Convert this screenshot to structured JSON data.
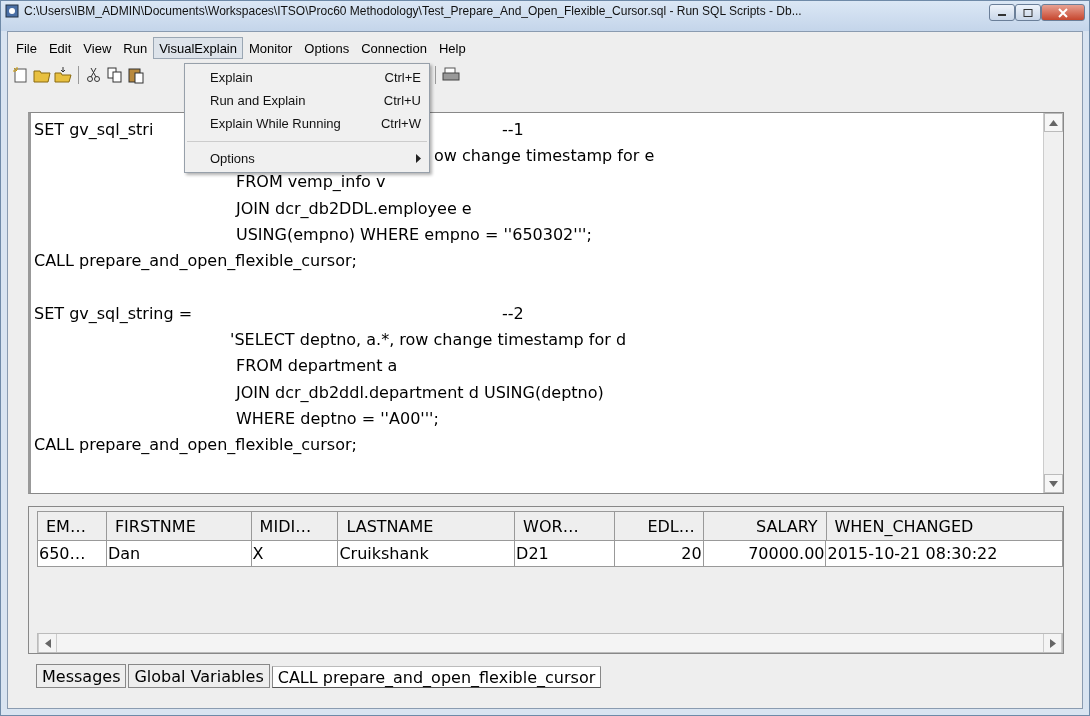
{
  "window": {
    "title": "C:\\Users\\IBM_ADMIN\\Documents\\Workspaces\\ITSO\\Proc60 Methodology\\Test_Prepare_And_Open_Flexible_Cursor.sql - Run SQL Scripts - Db..."
  },
  "menu_bar": [
    {
      "label": "File",
      "selected": false
    },
    {
      "label": "Edit",
      "selected": false
    },
    {
      "label": "View",
      "selected": false
    },
    {
      "label": "Run",
      "selected": false
    },
    {
      "label": "VisualExplain",
      "selected": true
    },
    {
      "label": "Monitor",
      "selected": false
    },
    {
      "label": "Options",
      "selected": false
    },
    {
      "label": "Connection",
      "selected": false
    },
    {
      "label": "Help",
      "selected": false
    }
  ],
  "dropdown": [
    {
      "kind": "item",
      "label": "Explain",
      "shortcut": "Ctrl+E"
    },
    {
      "kind": "item",
      "label": "Run and Explain",
      "shortcut": "Ctrl+U"
    },
    {
      "kind": "item",
      "label": "Explain While Running",
      "shortcut": "Ctrl+W"
    },
    {
      "kind": "separator"
    },
    {
      "kind": "submenu",
      "label": "Options"
    }
  ],
  "editor": [
    {
      "kind": "head",
      "text": "SET gv_sql_stri",
      "comment": "--1"
    },
    {
      "kind": "tail",
      "text": "ow change timestamp for e"
    },
    {
      "kind": "body",
      "text": "FROM vemp_info v"
    },
    {
      "kind": "body",
      "text": "JOIN dcr_db2DDL.employee e"
    },
    {
      "kind": "body",
      "text": "USING(empno) WHERE empno = ''650302''';"
    },
    {
      "kind": "head",
      "text": "CALL prepare_and_open_flexible_cursor;"
    },
    {
      "kind": "blank"
    },
    {
      "kind": "head",
      "text": "SET gv_sql_string =",
      "comment": "--2"
    },
    {
      "kind": "quote",
      "text": "'SELECT deptno, a.*, row change timestamp for d"
    },
    {
      "kind": "body",
      "text": "FROM department a"
    },
    {
      "kind": "body",
      "text": "JOIN dcr_db2ddl.department d USING(deptno)"
    },
    {
      "kind": "body",
      "text": "WHERE deptno = ''A00''';"
    },
    {
      "kind": "head",
      "text": "CALL prepare_and_open_flexible_cursor;"
    }
  ],
  "results": {
    "columns": [
      {
        "label": "EM…",
        "numeric": false
      },
      {
        "label": "FIRSTNME",
        "numeric": false
      },
      {
        "label": "MIDI…",
        "numeric": false
      },
      {
        "label": "LASTNAME",
        "numeric": false
      },
      {
        "label": "WOR…",
        "numeric": false
      },
      {
        "label": "EDL…",
        "numeric": true
      },
      {
        "label": "SALARY",
        "numeric": true
      },
      {
        "label": "WHEN_CHANGED",
        "numeric": false
      }
    ],
    "rows": [
      [
        "650…",
        "Dan",
        "X",
        "Cruikshank",
        "D21",
        "20",
        "70000.00",
        "2015-10-21 08:30:22"
      ]
    ]
  },
  "tabs": [
    {
      "label": "Messages",
      "selected": false
    },
    {
      "label": "Global Variables",
      "selected": false
    },
    {
      "label": "CALL prepare_and_open_flexible_cursor",
      "selected": true
    }
  ]
}
